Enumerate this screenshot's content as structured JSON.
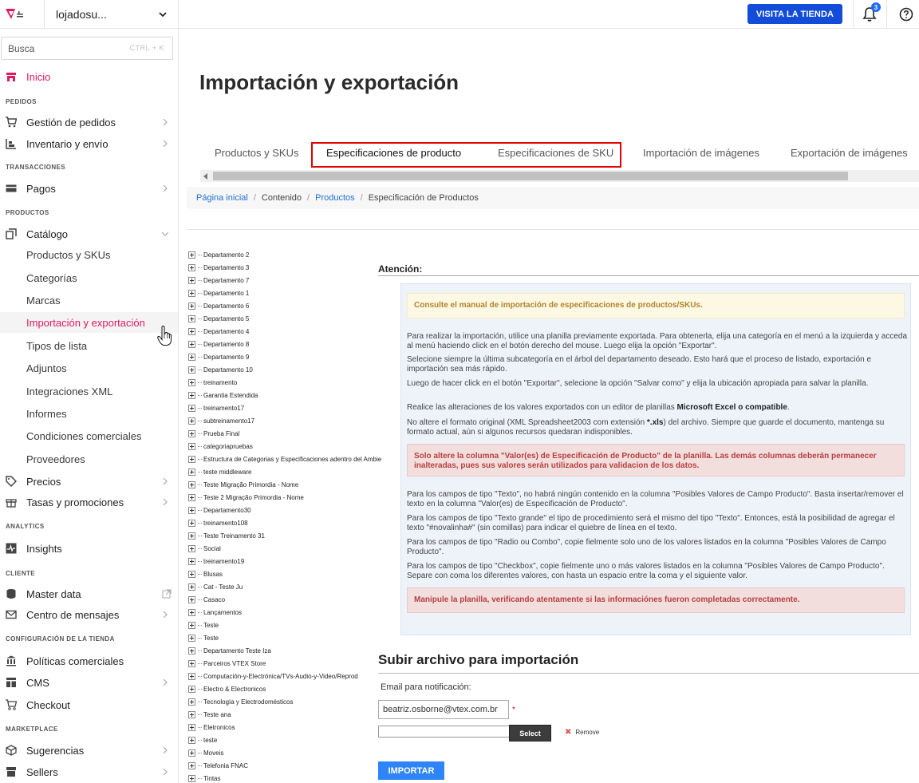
{
  "topbar": {
    "account_name": "lojadosu...",
    "visit_store_label": "VISITA LA TIENDA",
    "notifications_count": "3"
  },
  "sidebar": {
    "search_placeholder": "Busca",
    "search_shortcut": "CTRL + K",
    "home_label": "Inicio",
    "sections": {
      "pedidos": "PEDIDOS",
      "transacciones": "TRANSACCIONES",
      "productos": "PRODUCTOS",
      "analytics": "ANALYTICS",
      "cliente": "CLIENTE",
      "config": "CONFIGURACIÓN DE LA TIENDA",
      "marketplace": "MARKETPLACE"
    },
    "items": {
      "gestion_pedidos": "Gestión de pedidos",
      "inventario": "Inventario y envío",
      "pagos": "Pagos",
      "catalogo": "Catálogo",
      "precios": "Precios",
      "tasas": "Tasas y promociones",
      "insights": "Insights",
      "master_data": "Master data",
      "centro_mensajes": "Centro de mensajes",
      "politicas": "Políticas comerciales",
      "cms": "CMS",
      "checkout": "Checkout",
      "sugerencias": "Sugerencias",
      "sellers": "Sellers"
    },
    "catalog_sub": [
      "Productos y SKUs",
      "Categorías",
      "Marcas",
      "Importación y exportación",
      "Tipos de lista",
      "Adjuntos",
      "Integraciones XML",
      "Informes",
      "Condiciones comerciales",
      "Proveedores"
    ]
  },
  "main": {
    "title": "Importación y exportación",
    "tabs": [
      "Productos y SKUs",
      "Especificaciones de producto",
      "Especificaciones de SKU",
      "Importación de imágenes",
      "Exportación de imágenes"
    ],
    "breadcrumb": {
      "home": "Página inicial",
      "content": "Contenido",
      "products": "Productos",
      "current": "Especificación de Productos"
    }
  },
  "tree": [
    "Departamento 2",
    "Departamento 3",
    "Departamento 7",
    "Departamento 1",
    "Departamento 6",
    "Departamento 5",
    "Departamento 4",
    "Departamento 8",
    "Departamento 9",
    "Departamento 10",
    "treinamento",
    "Garantia Estendida",
    "treinamento17",
    "subtreinamento17",
    "Prueba Final",
    "categoriapruebas",
    "Estructura de Categorias y Especificaciones adentro del Ambie",
    "teste middleware",
    "Teste Migração Primordia - Nome",
    "Teste 2 Migração Primordia - Nome",
    "Departamento30",
    "treinamento108",
    "Teste Treinamento 31",
    "Social",
    "treinamento19",
    "Blusas",
    "Cat - Teste Ju",
    "Casaco",
    "Lançamentos",
    "Teste",
    "Teste",
    "Departamento Teste Iza",
    "Parceiros VTEX Store",
    "Computación-y-Electrónica/TVs-Audio-y-Video/Reprod",
    "Electro & Electronicos",
    "Tecnología y Electrodomésticos",
    "Teste ana",
    "Eletronicos",
    "teste",
    "Moveis",
    "Telefonia FNAC",
    "Tintas"
  ],
  "attention": {
    "title": "Atención:",
    "manual_note": "Consulte el manual de importación de especificaciones de productos/SKUs.",
    "p1": "Para realizar la importación, utilice una planilla previamente exportada. Para obtenerla, elija una categoría en el menú a la izquierda y acceda al menú haciendo click en el botón derecho del mouse. Luego elija la opción \"Exportar\".",
    "p2": "Selecione siempre la última subcategoría en el árbol del departamento deseado. Esto hará que el proceso de listado, exportación e importación sea más rápido.",
    "p3": "Luego de hacer click en el botón \"Exportar\", selecione la opción \"Salvar como\" y elija la ubicación apropiada para salvar la planilla.",
    "p4_prefix": "Realice las alteraciones de los valores exportados con un editor de planillas ",
    "p4_bold": "Microsoft Excel o compatible",
    "p4_suffix": ".",
    "p5_prefix": "No altere el formato original (XML Spreadsheet2003 com extensión ",
    "p5_bold": "*.xls",
    "p5_suffix": ") del archivo. Siempre que guarde el documento, mantenga su formato actual, aún si algunos recursos quedaran indisponibles.",
    "warn1": "Solo altere la columna \"Valor(es) de Especificación de Producto\" de la planilla. Las demás columnas deberán permanecer inalteradas, pues sus valores serán utilizados para validacion de los datos.",
    "p6": "Para los campos de tipo \"Texto\", no habrá ningún contenido en la columna \"Posibles Valores de Campo Producto\". Basta insertar/remover el texto en la columna \"Valor(es) de Especificación de Producto\".",
    "p7": "Para los campos de tipo \"Texto grande\" el tipo de procedimiento será el mismo del tipo \"Texto\". Entonces, está la posibilidad de agregar el texto \"#novalinha#\" (sin comillas) para indicar el quiebre de línea en el texto.",
    "p8": "Para los campos de tipo \"Radio ou Combo\", copie fielmente solo uno de los valores listados en la columna \"Posibles Valores de Campo Producto\".",
    "p9": "Para los campos de tipo \"Checkbox\", copie fielmente uno o más valores listados en la columna \"Posibles Valores de Campo Producto\". Separe con coma los diferentes valores, con hasta un espacio entre la coma y el siguiente valor.",
    "warn2": "Manipule la planilla, verificando atentamente si las informaciónes fueron completadas correctamente."
  },
  "upload": {
    "title": "Subir archivo para importación",
    "email_label": "Email para notificación:",
    "email_value": "beatriz.osborne@vtex.com.br",
    "required_mark": "*",
    "select_label": "Select",
    "remove_label": "Remove",
    "import_label": "IMPORTAR"
  },
  "colors": {
    "accent_pink": "#e11960",
    "primary_blue": "#134cd8",
    "link_blue": "#1f6fd1",
    "highlight_red": "#e00000"
  }
}
